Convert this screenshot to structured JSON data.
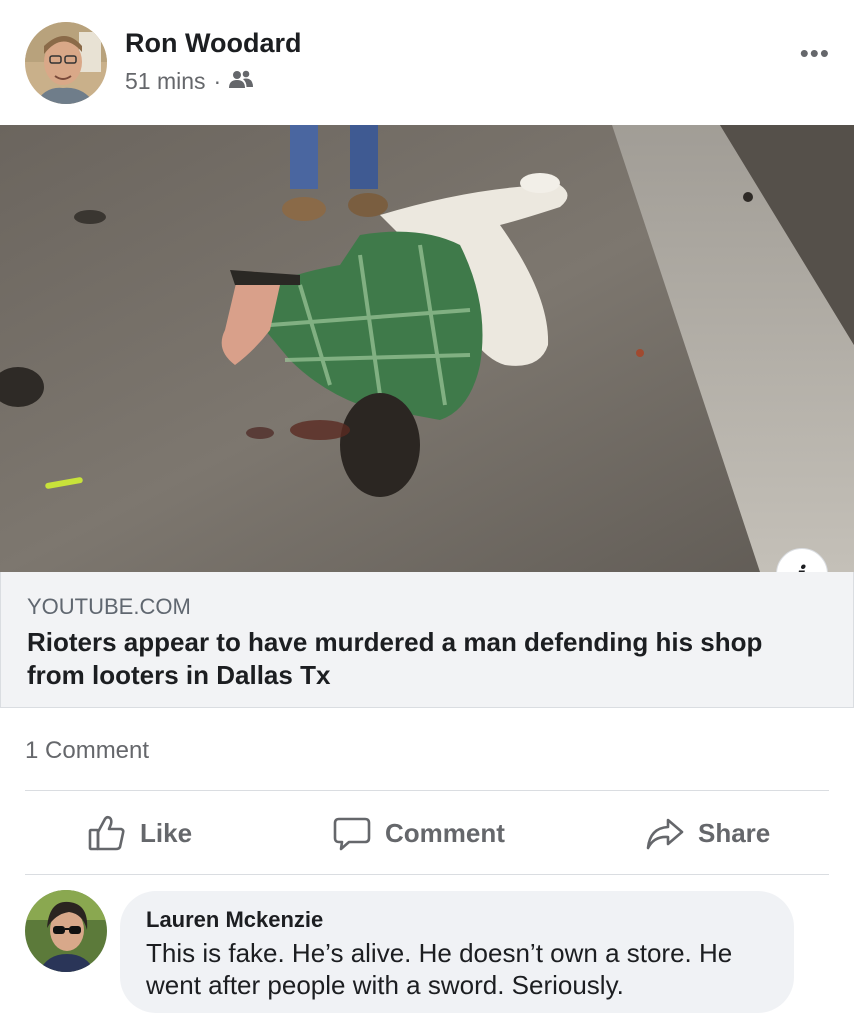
{
  "post": {
    "author": "Ron Woodard",
    "time": "51 mins",
    "separator": "·",
    "audience_icon": "friends-icon",
    "more_label": "•••"
  },
  "media": {
    "info_label": "i"
  },
  "link": {
    "domain": "YOUTUBE.COM",
    "title": "Rioters appear to have murdered a man defending his shop from looters in Dallas Tx"
  },
  "stats": {
    "comments": "1 Comment"
  },
  "actions": {
    "like": "Like",
    "comment": "Comment",
    "share": "Share"
  },
  "comment": {
    "author": "Lauren Mckenzie",
    "text": "This is fake. He’s alive. He doesn’t own a store. He went after people with a sword. Seriously."
  },
  "colors": {
    "secondary_text": "#65676b",
    "link_card_bg": "#f2f3f5",
    "comment_bubble_bg": "#f0f2f5",
    "divider": "#dadde1"
  }
}
